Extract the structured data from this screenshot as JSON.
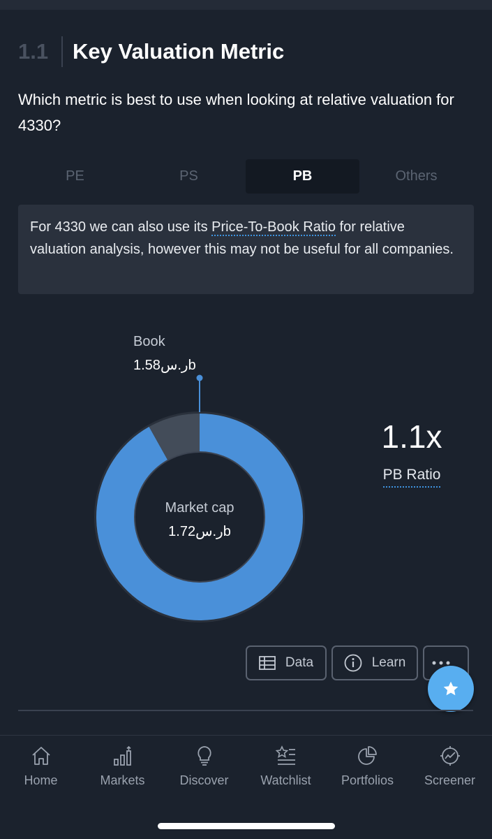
{
  "section": {
    "number": "1.1",
    "title": "Key Valuation Metric"
  },
  "question": "Which metric is best to use when looking at relative valuation for 4330?",
  "tabs": [
    {
      "label": "PE",
      "active": false
    },
    {
      "label": "PS",
      "active": false
    },
    {
      "label": "PB",
      "active": true
    },
    {
      "label": "Others",
      "active": false
    }
  ],
  "info": {
    "prefix": "For 4330 we can also use its ",
    "link": "Price-To-Book Ratio",
    "suffix": " for relative valuation analysis, however this may not be useful for all companies."
  },
  "chart_data": {
    "type": "pie",
    "donut": true,
    "slices": [
      {
        "name": "Book",
        "value": 1.58,
        "display": "ر.س1.58b",
        "color": "#434c59"
      },
      {
        "name": "Market cap",
        "value": 1.72,
        "display": "ر.س1.72b",
        "color": "#4a90d9"
      }
    ],
    "book_label": "Book",
    "book_value": "ر.س1.58b",
    "center_label": "Market cap",
    "center_value": "ر.س1.72b"
  },
  "ratio": {
    "value": "1.1x",
    "label": "PB Ratio"
  },
  "buttons": {
    "data": "Data",
    "learn": "Learn"
  },
  "nav": [
    {
      "label": "Home",
      "icon": "home-icon"
    },
    {
      "label": "Markets",
      "icon": "markets-icon"
    },
    {
      "label": "Discover",
      "icon": "lightbulb-icon"
    },
    {
      "label": "Watchlist",
      "icon": "watchlist-icon"
    },
    {
      "label": "Portfolios",
      "icon": "pie-chart-icon"
    },
    {
      "label": "Screener",
      "icon": "screener-icon"
    }
  ],
  "colors": {
    "background": "#1b222d",
    "accent": "#4a90d9",
    "fab": "#58aef0"
  }
}
